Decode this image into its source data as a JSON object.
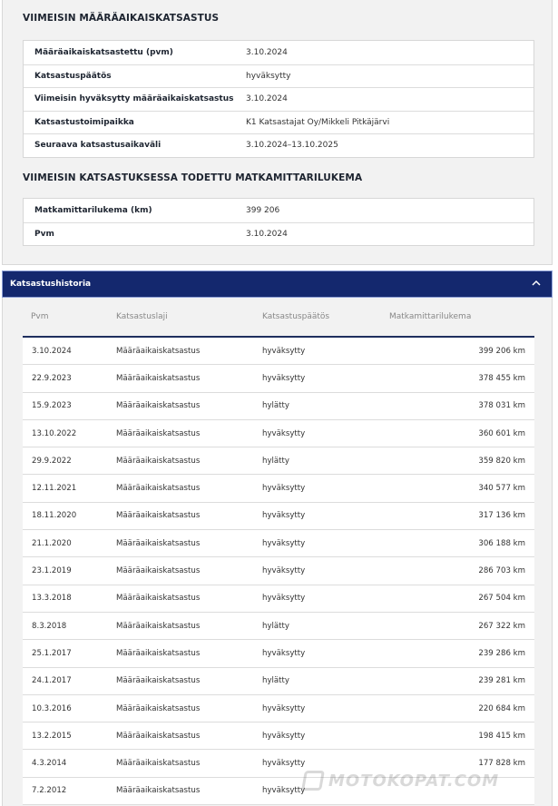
{
  "latest_inspection": {
    "title": "VIIMEISIN MÄÄRÄAIKAISKATSASTUS",
    "rows": [
      {
        "label": "Määräaikaiskatsastettu (pvm)",
        "value": "3.10.2024"
      },
      {
        "label": "Katsastuspäätös",
        "value": "hyväksytty"
      },
      {
        "label": "Viimeisin hyväksytty määräaikaiskatsastus",
        "value": "3.10.2024"
      },
      {
        "label": "Katsastustoimipaikka",
        "value": "K1 Katsastajat Oy/Mikkeli Pitkäjärvi"
      },
      {
        "label": "Seuraava katsastusaikaväli",
        "value": "3.10.2024–13.10.2025"
      }
    ]
  },
  "odometer": {
    "title": "VIIMEISIN KATSASTUKSESSA TODETTU MATKAMITTARILUKEMA",
    "rows": [
      {
        "label": "Matkamittarilukema (km)",
        "value": "399 206"
      },
      {
        "label": "Pvm",
        "value": "3.10.2024"
      }
    ]
  },
  "history": {
    "header_label": "Katsastushistoria",
    "chevron_icon": "chevron-up-icon",
    "columns": [
      "Pvm",
      "Katsastuslaji",
      "Katsastuspäätös",
      "Matkamittarilukema"
    ],
    "rows": [
      {
        "date": "3.10.2024",
        "type": "Määräaikaiskatsastus",
        "result": "hyväksytty",
        "km": "399 206 km"
      },
      {
        "date": "22.9.2023",
        "type": "Määräaikaiskatsastus",
        "result": "hyväksytty",
        "km": "378 455 km"
      },
      {
        "date": "15.9.2023",
        "type": "Määräaikaiskatsastus",
        "result": "hylätty",
        "km": "378 031 km"
      },
      {
        "date": "13.10.2022",
        "type": "Määräaikaiskatsastus",
        "result": "hyväksytty",
        "km": "360 601 km"
      },
      {
        "date": "29.9.2022",
        "type": "Määräaikaiskatsastus",
        "result": "hylätty",
        "km": "359 820 km"
      },
      {
        "date": "12.11.2021",
        "type": "Määräaikaiskatsastus",
        "result": "hyväksytty",
        "km": "340 577 km"
      },
      {
        "date": "18.11.2020",
        "type": "Määräaikaiskatsastus",
        "result": "hyväksytty",
        "km": "317 136 km"
      },
      {
        "date": "21.1.2020",
        "type": "Määräaikaiskatsastus",
        "result": "hyväksytty",
        "km": "306 188 km"
      },
      {
        "date": "23.1.2019",
        "type": "Määräaikaiskatsastus",
        "result": "hyväksytty",
        "km": "286 703 km"
      },
      {
        "date": "13.3.2018",
        "type": "Määräaikaiskatsastus",
        "result": "hyväksytty",
        "km": "267 504 km"
      },
      {
        "date": "8.3.2018",
        "type": "Määräaikaiskatsastus",
        "result": "hylätty",
        "km": "267 322 km"
      },
      {
        "date": "25.1.2017",
        "type": "Määräaikaiskatsastus",
        "result": "hyväksytty",
        "km": "239 286 km"
      },
      {
        "date": "24.1.2017",
        "type": "Määräaikaiskatsastus",
        "result": "hylätty",
        "km": "239 281 km"
      },
      {
        "date": "10.3.2016",
        "type": "Määräaikaiskatsastus",
        "result": "hyväksytty",
        "km": "220 684 km"
      },
      {
        "date": "13.2.2015",
        "type": "Määräaikaiskatsastus",
        "result": "hyväksytty",
        "km": "198 415 km"
      },
      {
        "date": "4.3.2014",
        "type": "Määräaikaiskatsastus",
        "result": "hyväksytty",
        "km": "177 828 km"
      },
      {
        "date": "7.2.2012",
        "type": "Määräaikaiskatsastus",
        "result": "hyväksytty",
        "km": ""
      }
    ]
  },
  "watermark": {
    "text": "MOTOKOPAT.COM"
  },
  "colors": {
    "header_bg": "#14286e",
    "panel_bg": "#f2f2f2",
    "header_rule": "#1f2f5e"
  }
}
